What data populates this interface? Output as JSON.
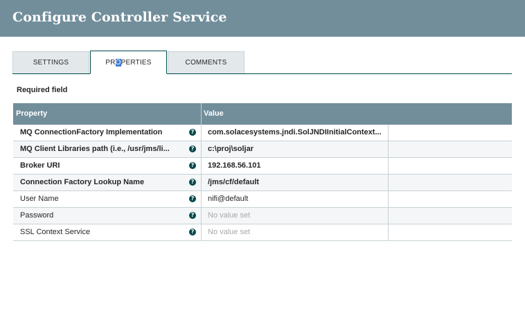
{
  "dialog": {
    "title": "Configure Controller Service"
  },
  "tabs": [
    {
      "label": "SETTINGS"
    },
    {
      "label_pre": "PR",
      "label_sel": "O",
      "label_post": "PERTIES"
    },
    {
      "label": "COMMENTS"
    }
  ],
  "required_note": "Required field",
  "grid": {
    "columns": {
      "property": "Property",
      "value": "Value"
    },
    "rows": [
      {
        "property": "MQ ConnectionFactory Implementation",
        "value": "com.solacesystems.jndi.SolJNDIInitialContext..."
      },
      {
        "property": "MQ Client Libraries path (i.e., /usr/jms/li...",
        "value": "c:\\proj\\soljar"
      },
      {
        "property": "Broker URI",
        "value": "192.168.56.101"
      },
      {
        "property": "Connection Factory Lookup Name",
        "value": "/jms/cf/default"
      },
      {
        "property": "User Name",
        "value": "nifi@default"
      },
      {
        "property": "Password",
        "value": "No value set"
      },
      {
        "property": "SSL Context Service",
        "value": "No value set"
      }
    ]
  },
  "icons": {
    "help": "question-circle-icon"
  },
  "colors": {
    "header_bg": "#728e9b",
    "accent": "#004849",
    "tab_bg": "#e3e8eb"
  }
}
